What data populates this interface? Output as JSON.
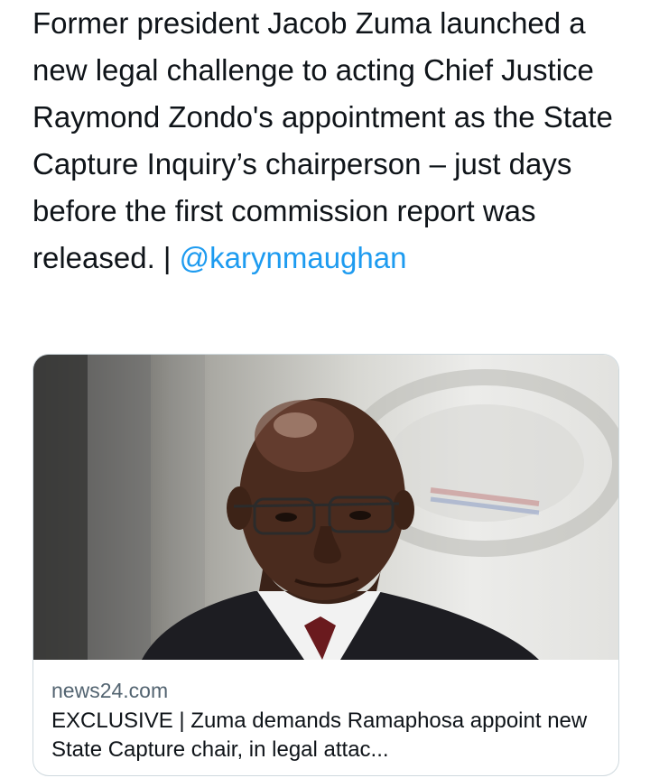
{
  "tweet": {
    "text": "Former president Jacob Zuma launched a new legal challenge to acting Chief Justice Raymond Zondo's appointment as the State Capture Inquiry’s chairperson – just days before the first commission report was released. | ",
    "mention": "@karynmaughan"
  },
  "card": {
    "image_alt": "Photo of Jacob Zuma wearing glasses",
    "domain": "news24.com",
    "headline": "EXCLUSIVE | Zuma demands Ramaphosa appoint new State Capture chair, in legal attac..."
  }
}
